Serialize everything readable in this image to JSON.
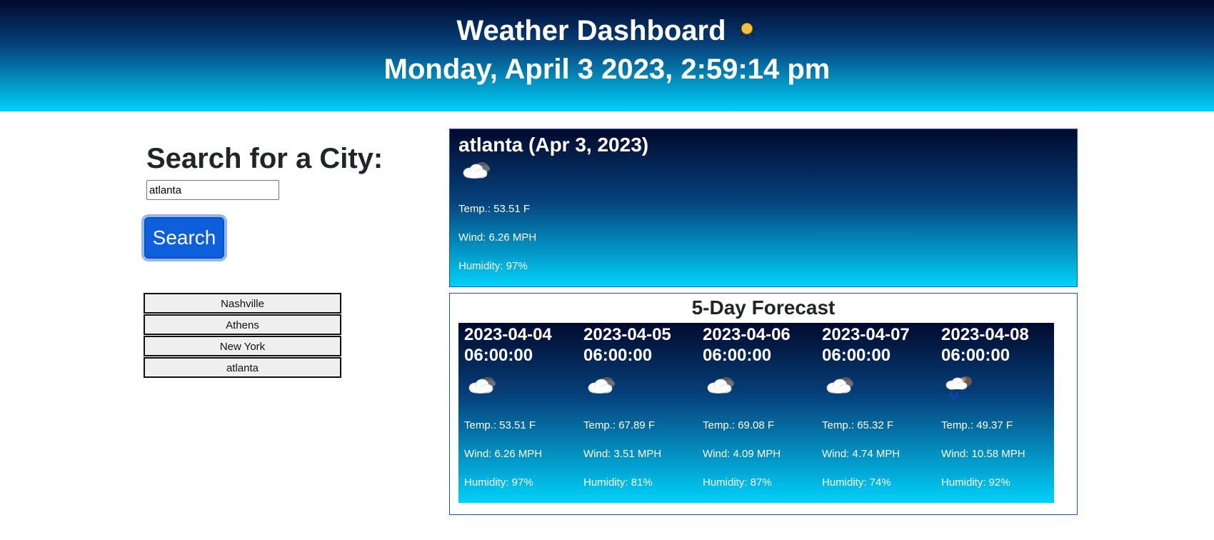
{
  "header": {
    "title": "Weather Dashboard",
    "title_icon": "sun-icon",
    "datetime": "Monday, April 3 2023, 2:59:14 pm"
  },
  "search": {
    "heading": "Search for a City:",
    "input_value": "atlanta",
    "button_label": "Search"
  },
  "history": [
    "Nashville",
    "Athens",
    "New York",
    "atlanta"
  ],
  "current": {
    "title": "atlanta (Apr 3, 2023)",
    "icon": "cloudy-icon",
    "temp": "Temp.: 53.51 F",
    "wind": "Wind: 6.26 MPH",
    "humidity": "Humidity: 97%"
  },
  "forecast": {
    "title": "5-Day Forecast",
    "days": [
      {
        "date": "2023-04-04",
        "time": "06:00:00",
        "icon": "cloudy-icon",
        "temp": "Temp.: 53.51 F",
        "wind": "Wind: 6.26 MPH",
        "humidity": "Humidity: 97%"
      },
      {
        "date": "2023-04-05",
        "time": "06:00:00",
        "icon": "cloudy-icon",
        "temp": "Temp.: 67.89 F",
        "wind": "Wind: 3.51 MPH",
        "humidity": "Humidity: 81%"
      },
      {
        "date": "2023-04-06",
        "time": "06:00:00",
        "icon": "cloudy-icon",
        "temp": "Temp.: 69.08 F",
        "wind": "Wind: 4.09 MPH",
        "humidity": "Humidity: 87%"
      },
      {
        "date": "2023-04-07",
        "time": "06:00:00",
        "icon": "cloudy-icon",
        "temp": "Temp.: 65.32 F",
        "wind": "Wind: 4.74 MPH",
        "humidity": "Humidity: 74%"
      },
      {
        "date": "2023-04-08",
        "time": "06:00:00",
        "icon": "rain-icon",
        "temp": "Temp.: 49.37 F",
        "wind": "Wind: 10.58 MPH",
        "humidity": "Humidity: 92%"
      }
    ]
  }
}
